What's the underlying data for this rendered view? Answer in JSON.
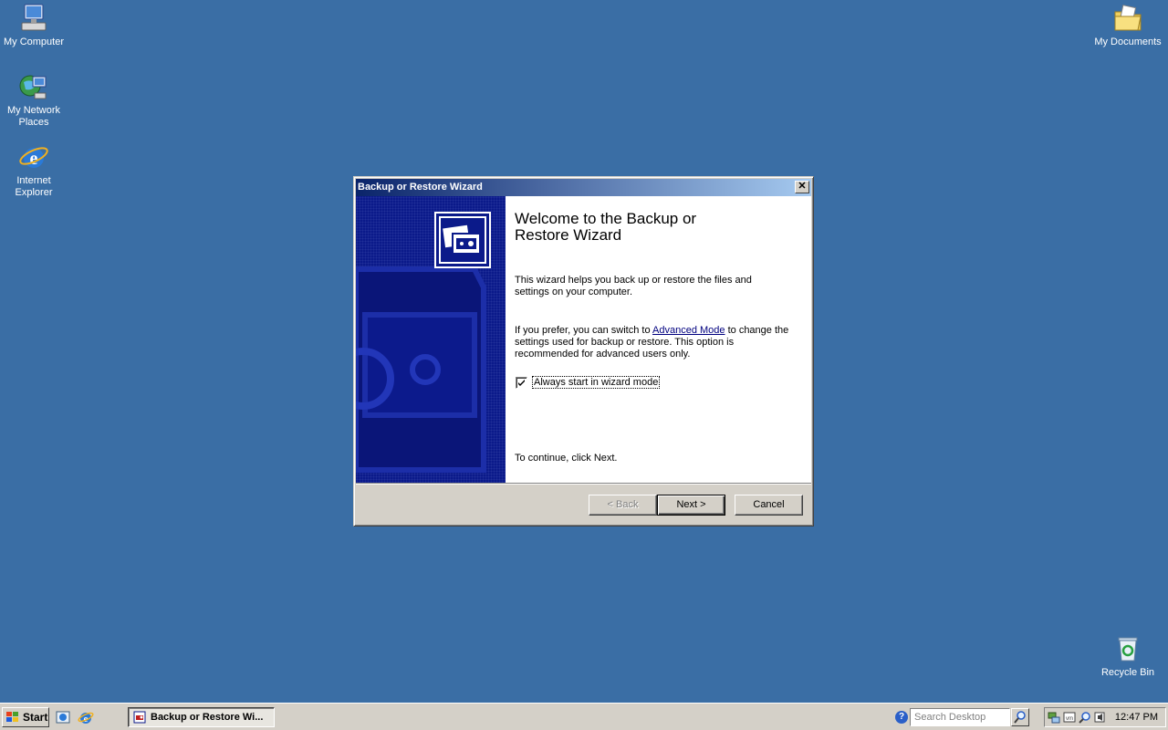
{
  "desktop": {
    "icons": [
      {
        "label": "My Computer"
      },
      {
        "label": "My Network Places"
      },
      {
        "label": "Internet Explorer"
      },
      {
        "label": "My Documents"
      },
      {
        "label": "Recycle Bin"
      }
    ]
  },
  "window": {
    "title": "Backup or Restore Wizard",
    "close_symbol": "✕",
    "heading": "Welcome to the Backup or Restore Wizard",
    "intro": "This wizard helps you back up or restore the files and settings on your computer.",
    "advanced_prefix": "If you prefer, you can switch to ",
    "advanced_link": "Advanced Mode",
    "advanced_suffix": " to change the settings used for backup or restore. This option is recommended for advanced users only.",
    "checkbox_label": "Always start in wizard mode",
    "checkbox_checked": true,
    "continue_text": "To continue, click Next.",
    "buttons": {
      "back": "< Back",
      "next": "Next >",
      "cancel": "Cancel"
    }
  },
  "taskbar": {
    "start_label": "Start",
    "task_label": "Backup or Restore Wi...",
    "search_placeholder": "Search Desktop",
    "help_symbol": "?",
    "clock": "12:47 PM"
  },
  "colors": {
    "desktop": "#3a6ea5",
    "titlebar_start": "#0a246a",
    "titlebar_end": "#a6caf0",
    "wizard_side": "#0b1a8a"
  }
}
